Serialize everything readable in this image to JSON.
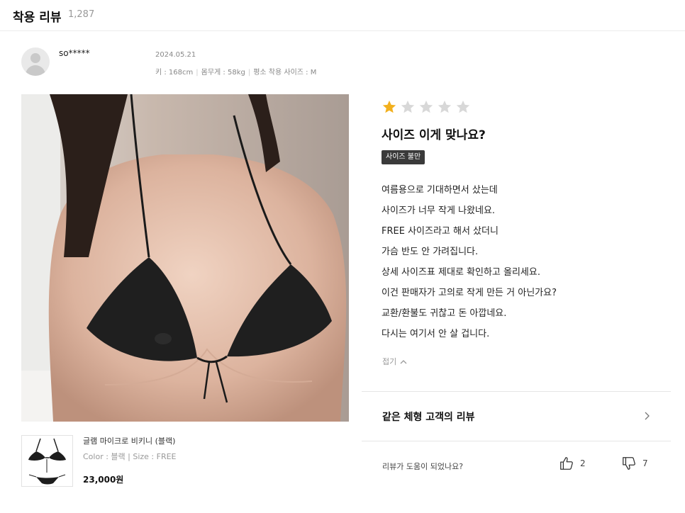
{
  "header": {
    "title": "착용 리뷰",
    "count": "1,287"
  },
  "review": {
    "username": "so*****",
    "date": "2024.05.21",
    "specs": [
      "키 : 168cm",
      "몸무게 : 58kg",
      "평소 착용 사이즈 : M"
    ],
    "rating": 1,
    "max_rating": 5,
    "title": "사이즈 이게 맞나요?",
    "badge": "사이즈 불만",
    "body_lines": [
      "여름용으로 기대하면서 샀는데",
      "사이즈가 너무 작게 나왔네요.",
      "FREE 사이즈라고 해서 샀더니",
      "가슴 반도 안 가려집니다.",
      "상세 사이즈표 제대로 확인하고 올리세요.",
      "이건 판매자가 고의로 작게 만든 거 아닌가요?",
      "교환/환불도 귀찮고 돈 아깝네요.",
      "다시는 여기서 안 살 겁니다."
    ],
    "fold_label": "접기"
  },
  "product": {
    "name": "글램 마이크로 비키니 (블랙)",
    "option": "Color : 블랙 | Size : FREE",
    "price": "23,000원"
  },
  "same_body": {
    "label": "같은 체형 고객의 리뷰"
  },
  "feedback": {
    "question": "리뷰가 도움이 되었나요?",
    "helpful_count": "2",
    "unhelpful_count": "7"
  },
  "colors": {
    "star_filled": "#f2b01e",
    "star_empty": "#d8d8d8",
    "badge_bg": "#3a3a3a"
  },
  "icons": {
    "avatar": "avatar-placeholder-icon",
    "fold": "chevron-up-icon",
    "more": "chevron-right-icon",
    "like": "thumbs-up-icon",
    "dislike": "thumbs-down-icon"
  }
}
